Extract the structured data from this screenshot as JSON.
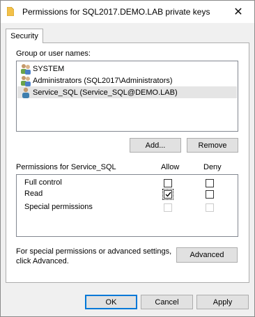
{
  "window": {
    "title": "Permissions for SQL2017.DEMO.LAB private keys",
    "close_glyph": "✕"
  },
  "tab": {
    "label": "Security"
  },
  "group": {
    "label": "Group or user names:",
    "items": [
      {
        "label": "SYSTEM",
        "icon": "user-group-icon"
      },
      {
        "label": "Administrators (SQL2017\\Administrators)",
        "icon": "user-group-icon"
      },
      {
        "label": "Service_SQL (Service_SQL@DEMO.LAB)",
        "icon": "user-icon",
        "selected": true
      }
    ]
  },
  "buttons": {
    "add": "Add...",
    "remove": "Remove",
    "advanced": "Advanced",
    "ok": "OK",
    "cancel": "Cancel",
    "apply": "Apply"
  },
  "permissions": {
    "header": "Permissions for Service_SQL",
    "allow_header": "Allow",
    "deny_header": "Deny",
    "rows": [
      {
        "label": "Full control",
        "allow": false,
        "deny": false,
        "disabled": false
      },
      {
        "label": "Read",
        "allow": true,
        "deny": false,
        "disabled": false
      },
      {
        "label": "Special permissions",
        "allow": false,
        "deny": false,
        "disabled": true
      }
    ]
  },
  "advanced_text": {
    "line1": "For special permissions or advanced settings,",
    "line2": "click Advanced."
  },
  "colors": {
    "accent": "#0078d7",
    "selected_row": "#e5e5e5"
  }
}
